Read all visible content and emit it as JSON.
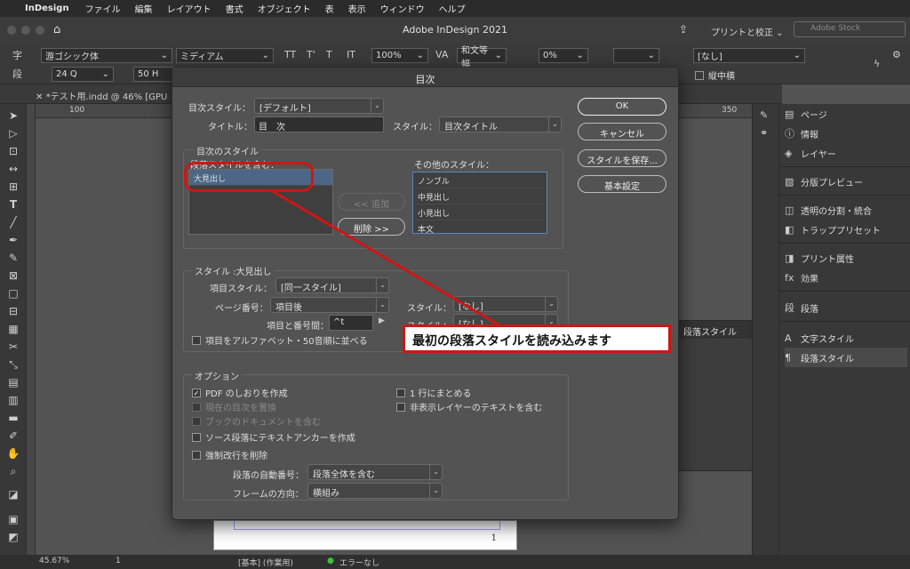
{
  "menubar": {
    "app": "InDesign",
    "items": [
      "ファイル",
      "編集",
      "レイアウト",
      "書式",
      "オブジェクト",
      "表",
      "表示",
      "ウィンドウ",
      "ヘルプ"
    ]
  },
  "titlebar": {
    "title": "Adobe InDesign 2021",
    "print_label": "プリントと校正 ⌄",
    "stock_placeholder": "Adobe Stock"
  },
  "control": {
    "font": "游ゴシック体",
    "weight": "ミディアム",
    "size": "24 Q",
    "leading": "50 H",
    "scale": "100%",
    "kerning": "和文等幅",
    "tracking": "0%",
    "style_none": "[なし]",
    "vertical": "縦中横"
  },
  "doctab": {
    "name": "*テスト用.indd @ 46% [GPU プレ",
    "ruler_left": "100",
    "ruler_right": "350"
  },
  "dialog": {
    "title": "目次",
    "toc_style_label": "目次スタイル：",
    "toc_style_value": "[デフォルト]",
    "title_label": "タイトル：",
    "title_value": "目　次",
    "style_label": "スタイル：",
    "title_style_value": "目次タイトル",
    "group_toc_styles": "目次のスタイル",
    "include_label": "段落スタイルを含む：",
    "included": [
      "大見出し"
    ],
    "add_button": "<< 追加",
    "remove_button": "削除 >>",
    "other_label": "その他のスタイル：",
    "others": [
      "ノンブル",
      "中見出し",
      "小見出し",
      "本文"
    ],
    "group_style": "スタイル :大見出し",
    "entry_style_label": "項目スタイル：",
    "entry_style_value": "[同一スタイル]",
    "page_number_label": "ページ番号：",
    "page_number_value": "項目後",
    "pn_style_label": "スタイル：",
    "pn_style_value": "[なし]",
    "between_label": "項目と番号間：",
    "between_value": "^t",
    "between_style_label": "スタイル：",
    "between_style_value": "[なし]",
    "sort_label": "項目をアルファベット・50音順に並べる",
    "group_options": "オプション",
    "opt_pdf": "PDF のしおりを作成",
    "opt_replace": "現在の目次を置換",
    "opt_book": "ブックのドキュメントを含む",
    "opt_anchor": "ソース段落にテキストアンカーを作成",
    "opt_remove_breaks": "強制改行を削除",
    "opt_one_line": "1 行にまとめる",
    "opt_hidden": "非表示レイヤーのテキストを含む",
    "numbering_label": "段落の自動番号：",
    "numbering_value": "段落全体を含む",
    "frame_dir_label": "フレームの方向：",
    "frame_dir_value": "横組み",
    "ok": "OK",
    "cancel": "キャンセル",
    "save_style": "スタイルを保存...",
    "basic": "基本設定"
  },
  "callout": "最初の段落スタイルを読み込みます",
  "panels": {
    "items": [
      "ページ",
      "情報",
      "レイヤー",
      "分版プレビュー",
      "透明の分割・統合",
      "トラッププリセット",
      "プリント属性",
      "効果",
      "段落",
      "文字スタイル",
      "段落スタイル"
    ]
  },
  "floatpanel": {
    "title": "段落スタイル"
  },
  "status": {
    "zoom": "45.67%",
    "page": "1",
    "preflight_profile": "[基本] (作業用)",
    "errors": "エラーなし"
  }
}
